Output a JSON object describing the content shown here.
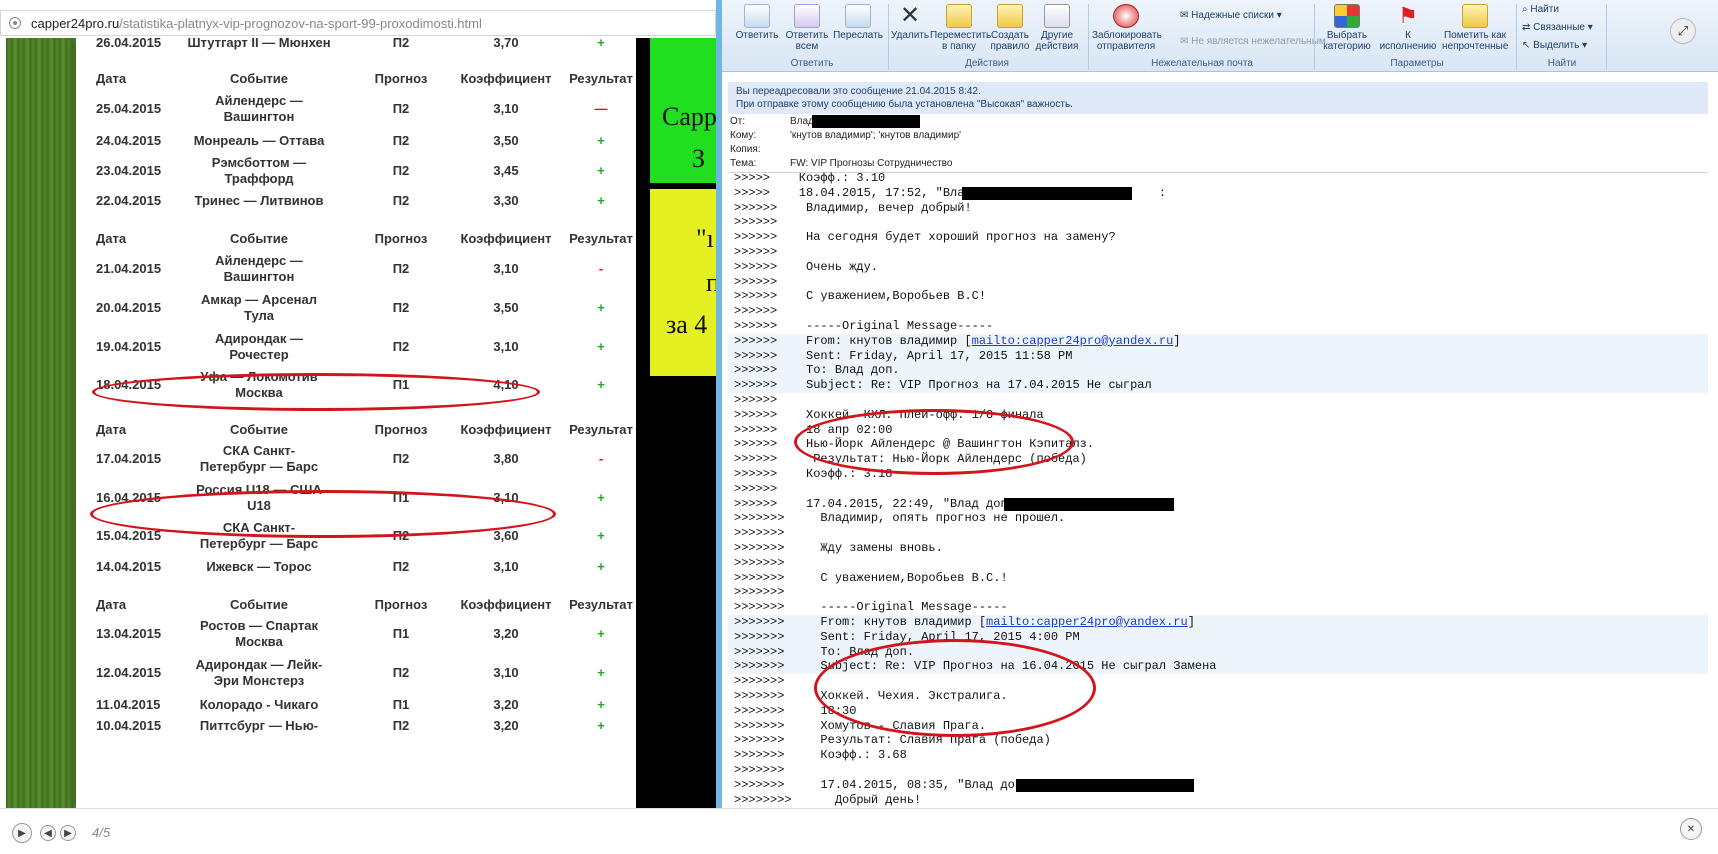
{
  "browser": {
    "url_host": "capper24pro.ru",
    "url_path": "/statistika-platnyx-vip-prognozov-na-sport-99-proxodimosti.html"
  },
  "site": {
    "top_row": {
      "date": "26.04.2015",
      "event": "Штутгарт II — Мюнхен",
      "pick": "П2",
      "coef": "3,70",
      "result": "+"
    },
    "headers": {
      "date": "Дата",
      "event": "Событие",
      "pick": "Прогноз",
      "coef": "Коэффициент",
      "result": "Результат"
    },
    "blocks": [
      [
        {
          "date": "25.04.2015",
          "event_l1": "Айлендерс —",
          "event_l2": "Вашингтон",
          "pick": "П2",
          "coef": "3,10",
          "result": "—",
          "res_class": "minus"
        },
        {
          "date": "24.04.2015",
          "event_l1": "Монреаль — Оттава",
          "event_l2": "",
          "pick": "П2",
          "coef": "3,50",
          "result": "+",
          "res_class": "plus"
        },
        {
          "date": "23.04.2015",
          "event_l1": "Рэмсботтом —",
          "event_l2": "Траффорд",
          "pick": "П2",
          "coef": "3,45",
          "result": "+",
          "res_class": "plus"
        },
        {
          "date": "22.04.2015",
          "event_l1": "Тринес — Литвинов",
          "event_l2": "",
          "pick": "П2",
          "coef": "3,30",
          "result": "+",
          "res_class": "plus"
        }
      ],
      [
        {
          "date": "21.04.2015",
          "event_l1": "Айлендерс —",
          "event_l2": "Вашингтон",
          "pick": "П2",
          "coef": "3,10",
          "result": "-",
          "res_class": "minus"
        },
        {
          "date": "20.04.2015",
          "event_l1": "Амкар — Арсенал",
          "event_l2": "Тула",
          "pick": "П2",
          "coef": "3,50",
          "result": "+",
          "res_class": "plus"
        },
        {
          "date": "19.04.2015",
          "event_l1": "Адирондак —",
          "event_l2": "Рочестер",
          "pick": "П2",
          "coef": "3,10",
          "result": "+",
          "res_class": "plus"
        },
        {
          "date": "18.04.2015",
          "event_l1": "Уфа — Локомотив",
          "event_l2": "Москва",
          "pick": "П1",
          "coef": "4,10",
          "result": "+",
          "res_class": "plus"
        }
      ],
      [
        {
          "date": "17.04.2015",
          "event_l1": "СКА Санкт-",
          "event_l2": "Петербург — Барс",
          "pick": "П2",
          "coef": "3,80",
          "result": "-",
          "res_class": "minus"
        },
        {
          "date": "16.04.2015",
          "event_l1": "Россия U18 — США",
          "event_l2": "U18",
          "pick": "П1",
          "coef": "3,10",
          "result": "+",
          "res_class": "plus"
        },
        {
          "date": "15.04.2015",
          "event_l1": "СКА Санкт-",
          "event_l2": "Петербург — Барс",
          "pick": "П2",
          "coef": "3,60",
          "result": "+",
          "res_class": "plus"
        },
        {
          "date": "14.04.2015",
          "event_l1": "Ижевск — Торос",
          "event_l2": "",
          "pick": "П2",
          "coef": "3,10",
          "result": "+",
          "res_class": "plus"
        }
      ],
      [
        {
          "date": "13.04.2015",
          "event_l1": "Ростов — Спартак",
          "event_l2": "Москва",
          "pick": "П1",
          "coef": "3,20",
          "result": "+",
          "res_class": "plus"
        },
        {
          "date": "12.04.2015",
          "event_l1": "Адирондак — Лейк-",
          "event_l2": "Эри Монстерз",
          "pick": "П2",
          "coef": "3,10",
          "result": "+",
          "res_class": "plus"
        },
        {
          "date": "11.04.2015",
          "event_l1": "Колорадо - Чикаго",
          "event_l2": "",
          "pick": "П1",
          "coef": "3,20",
          "result": "+",
          "res_class": "plus"
        },
        {
          "date": "10.04.2015",
          "event_l1": "Питтсбург — Нью-",
          "event_l2": "",
          "pick": "П2",
          "coef": "3,20",
          "result": "+",
          "res_class": "plus"
        }
      ]
    ],
    "side_text": {
      "l1": "Capp",
      "l2": "З",
      "l3": "\"ı",
      "l4": "п",
      "l5": "за 4"
    }
  },
  "outlook": {
    "ribbon": {
      "reply": "Ответить",
      "reply_all": "Ответить всем",
      "forward": "Переслать",
      "group_respond": "Ответить",
      "delete": "Удалить",
      "move": "Переместить в папку",
      "create_rule": "Создать правило",
      "other_actions": "Другие действия",
      "group_actions": "Действия",
      "block_sender": "Заблокировать отправителя",
      "safe_lists": "Надежные списки",
      "not_junk": "Не является нежелательным",
      "group_junk": "Нежелательная почта",
      "categorize": "Выбрать категорию",
      "followup": "К исполнению",
      "mark_unread": "Пометить как непрочтенные",
      "group_options": "Параметры",
      "find": "Найти",
      "related": "Связанные",
      "select": "Выделить",
      "group_find": "Найти"
    },
    "info_l1": "Вы переадресовали это сообщение 21.04.2015 8:42.",
    "info_l2": "При отправке этому сообщению была установлена \"Высокая\" важность.",
    "from_label": "От:",
    "from_value": "Влад",
    "to_label": "Кому:",
    "to_value": "'кнутов владимир'; 'кнутов владимир'",
    "cc_label": "Копия:",
    "cc_value": "",
    "subject_label": "Тема:",
    "subject_value": "FW: VIP Прогнозы Сотрудничество",
    "lines": [
      ">>>>>    Коэфф.: 3.10",
      ">>>>>    18.04.2015, 17:52, \"Влад\" <                       :",
      ">>>>>>    Владимир, вечер добрый!",
      ">>>>>>",
      ">>>>>>    На сегодня будет хороший прогноз на замену?",
      ">>>>>>",
      ">>>>>>    Очень жду.",
      ">>>>>>",
      ">>>>>>    С уважением,Воробьев В.С!",
      ">>>>>>",
      ">>>>>>    -----Original Message-----",
      ">>>>>>    From: кнутов владимир [",
      ">>>>>>    Sent: Friday, April 17, 2015 11:58 PM",
      ">>>>>>    To: Влад доп.",
      ">>>>>>    Subject: Re: VIP Прогноз на 17.04.2015 Не сыграл",
      ">>>>>>",
      ">>>>>>    Хоккей. КХЛ. Плей-офф. 1/8 финала",
      ">>>>>>    18 апр 02:00",
      ">>>>>>    Нью-Йорк Айлендерс @ Вашингтон Кэпиталз.",
      ">>>>>>     Результат: Нью-Йорк Айлендерс (победа)",
      ">>>>>>    Коэфф.: 3.18",
      ">>>>>>",
      ">>>>>>    17.04.2015, 22:49, \"Влад доп.\" <",
      ">>>>>>>     Владимир, опять прогноз не прошел.",
      ">>>>>>>",
      ">>>>>>>     Жду замены вновь.",
      ">>>>>>>",
      ">>>>>>>     С уважением,Воробьев В.С.!",
      ">>>>>>>",
      ">>>>>>>     -----Original Message-----",
      ">>>>>>>     From: кнутов владимир [",
      ">>>>>>>     Sent: Friday, April 17, 2015 4:00 PM",
      ">>>>>>>     To: Влад доп.",
      ">>>>>>>     Subject: Re: VIP Прогноз на 16.04.2015 Не сыграл Замена",
      ">>>>>>>",
      ">>>>>>>     Хоккей. Чехия. Экстралига.",
      ">>>>>>>     18:30",
      ">>>>>>>     Хомутов - Славия Прага.",
      ">>>>>>>     Результат: Славия Прага (победа)",
      ">>>>>>>     Коэфф.: 3.68",
      ">>>>>>>",
      ">>>>>>>     17.04.2015, 08:35, \"Влад доп.\" <",
      ">>>>>>>>      Добрый день!"
    ],
    "mailto": "mailto:capper24pro@yandex.ru"
  },
  "viewer": {
    "counter": "4/5"
  }
}
